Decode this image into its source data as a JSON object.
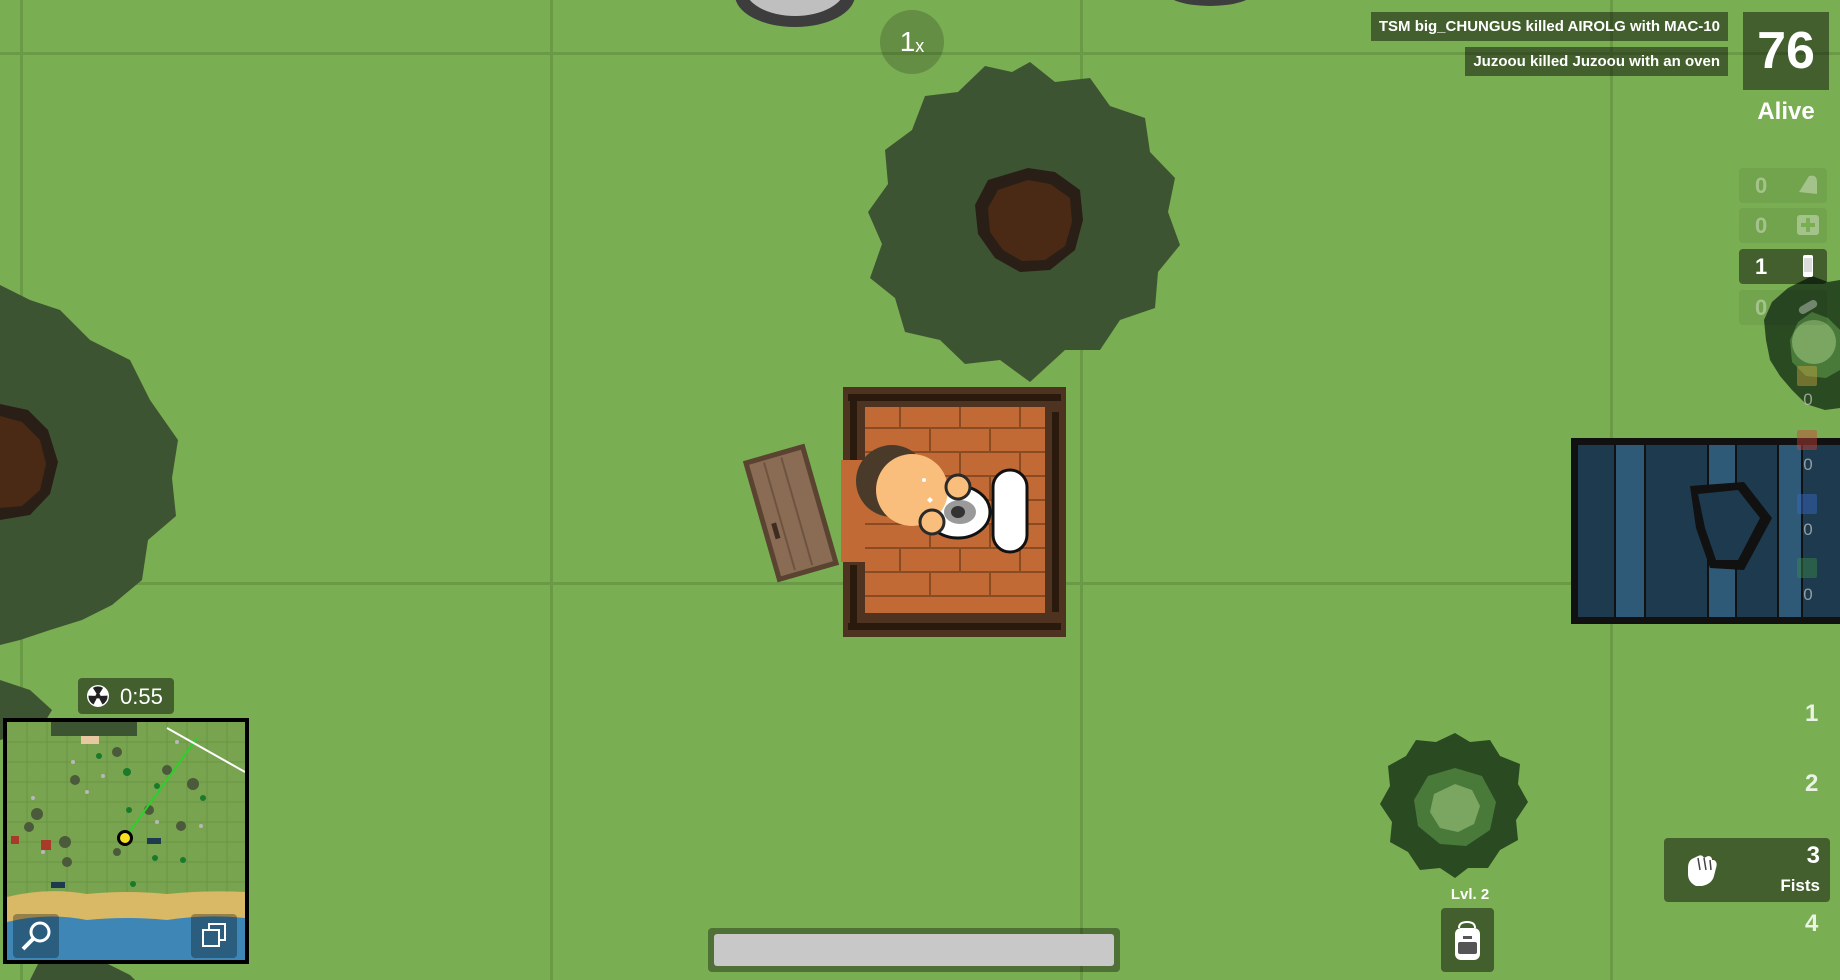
{
  "hud": {
    "zoom": "1",
    "zoom_suffix": "x",
    "killfeed": [
      "TSM big_CHUNGUS killed AIROLG with MAC-10",
      "Juzoou killed Juzoou with an oven"
    ],
    "alive_count": "76",
    "alive_label": "Alive"
  },
  "inventory": {
    "items": [
      {
        "name": "bandage-icon",
        "count": "0",
        "active": false
      },
      {
        "name": "medkit-icon",
        "count": "0",
        "active": false
      },
      {
        "name": "soda-icon",
        "count": "1",
        "active": true
      },
      {
        "name": "pills-icon",
        "count": "0",
        "active": false
      }
    ],
    "ammo_counts": [
      "0",
      "0",
      "0",
      "0"
    ],
    "ammo_colors": [
      "#c7a340",
      "#c8453a",
      "#3a6ac8",
      "#3a8a48"
    ]
  },
  "gas": {
    "icon": "radiation-icon",
    "timer": "0:55"
  },
  "player": {
    "health": 1.0
  },
  "backpack": {
    "level_label": "Lvl. 2",
    "icon": "backpack-icon"
  },
  "weapons": {
    "slot1": "1",
    "slot2": "2",
    "active_slot": "3",
    "active_name": "Fists",
    "active_icon": "fist-icon",
    "slot4": "4"
  },
  "colors": {
    "grass": "#7aae52",
    "tree_canopy": "#3d5432",
    "tree_trunk": "#4a2a14",
    "hud_panel": "rgba(0,0,0,0.45)",
    "player_skin": "#f9bd7c",
    "health": "#c8c8c8"
  }
}
